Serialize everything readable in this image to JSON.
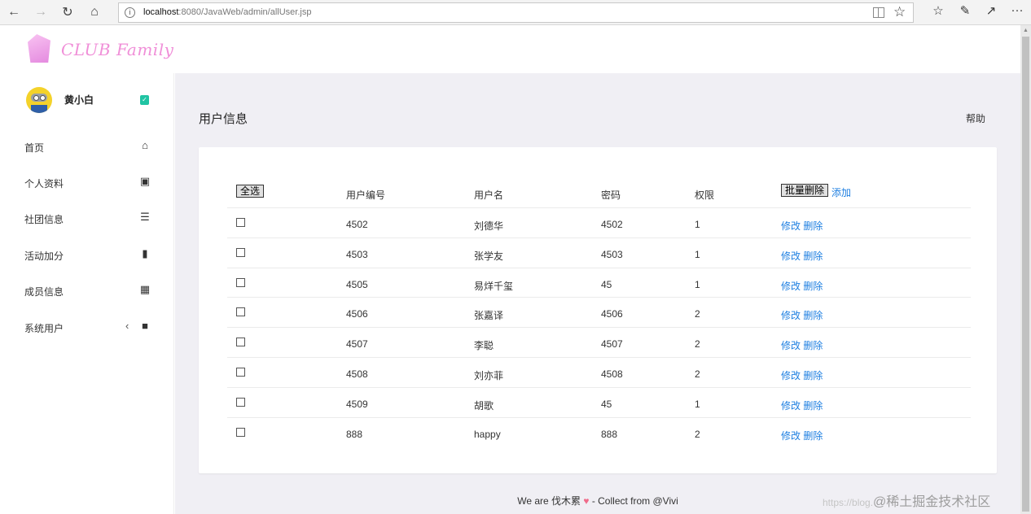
{
  "browser": {
    "url_host": "localhost",
    "url_path": ":8080/JavaWeb/admin/allUser.jsp"
  },
  "brand": {
    "logo_text": "CLUB Family"
  },
  "user": {
    "name": "黄小白"
  },
  "sidebar": {
    "items": [
      {
        "label": "首页",
        "icon": "home-icon"
      },
      {
        "label": "个人资料",
        "icon": "profile-card-icon"
      },
      {
        "label": "社团信息",
        "icon": "list-icon"
      },
      {
        "label": "活动加分",
        "icon": "bar-chart-icon"
      },
      {
        "label": "成员信息",
        "icon": "table-icon"
      },
      {
        "label": "系统用户",
        "icon": "user-lock-icon"
      }
    ]
  },
  "main": {
    "title": "用户信息",
    "help": "帮助"
  },
  "table": {
    "select_all": "全选",
    "columns": [
      "用户编号",
      "用户名",
      "密码",
      "权限"
    ],
    "batch_delete": "批量删除",
    "add": "添加",
    "edit_label": "修改",
    "delete_label": "删除",
    "rows": [
      {
        "id": "4502",
        "name": "刘德华",
        "password": "4502",
        "role": "1"
      },
      {
        "id": "4503",
        "name": "张学友",
        "password": "4503",
        "role": "1"
      },
      {
        "id": "4505",
        "name": "易烊千玺",
        "password": "45",
        "role": "1"
      },
      {
        "id": "4506",
        "name": "张嘉译",
        "password": "4506",
        "role": "2"
      },
      {
        "id": "4507",
        "name": "李聪",
        "password": "4507",
        "role": "2"
      },
      {
        "id": "4508",
        "name": "刘亦菲",
        "password": "4508",
        "role": "2"
      },
      {
        "id": "4509",
        "name": "胡歌",
        "password": "45",
        "role": "1"
      },
      {
        "id": "888",
        "name": "happy",
        "password": "888",
        "role": "2"
      }
    ]
  },
  "footer": {
    "prefix": "We are 伐木累",
    "suffix": " - Collect from @Vivi"
  },
  "watermark": {
    "url": "https://blog.",
    "text": "@稀土掘金技术社区"
  },
  "colors": {
    "link": "#1e7fe1",
    "logo": "#f08fd8",
    "badge": "#20c4a3",
    "main_bg": "#f0eff4"
  }
}
